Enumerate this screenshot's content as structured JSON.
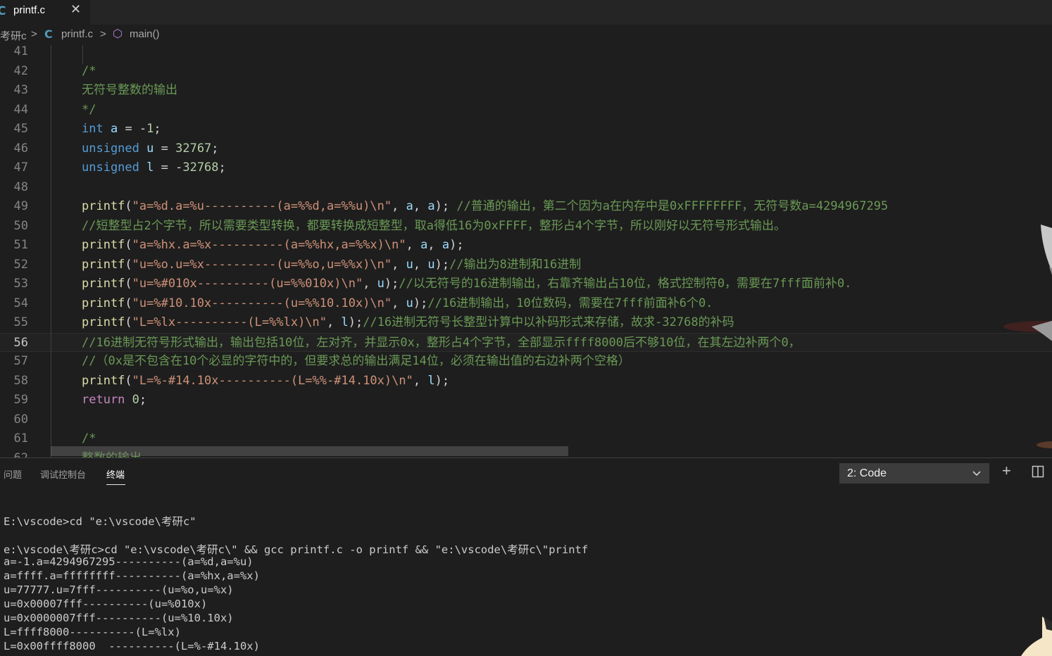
{
  "tab": {
    "icon": "C",
    "label": "printf.c",
    "close": "✕"
  },
  "breadcrumb": {
    "folder": "考研c",
    "sep": ">",
    "file_icon": "C",
    "file": "printf.c",
    "symbol_icon": "⬡",
    "symbol": "main()"
  },
  "editor": {
    "lines": [
      {
        "n": "41",
        "tokens": []
      },
      {
        "n": "42",
        "tokens": [
          [
            "cmt",
            "/*"
          ]
        ]
      },
      {
        "n": "43",
        "tokens": [
          [
            "cmt",
            "无符号整数的输出"
          ]
        ]
      },
      {
        "n": "44",
        "tokens": [
          [
            "cmt",
            "*/"
          ]
        ]
      },
      {
        "n": "45",
        "tokens": [
          [
            "kw",
            "int"
          ],
          [
            "pun",
            " "
          ],
          [
            "var",
            "a"
          ],
          [
            "pun",
            " = -"
          ],
          [
            "num",
            "1"
          ],
          [
            "pun",
            ";"
          ]
        ]
      },
      {
        "n": "46",
        "tokens": [
          [
            "kw",
            "unsigned"
          ],
          [
            "pun",
            " "
          ],
          [
            "var",
            "u"
          ],
          [
            "pun",
            " = "
          ],
          [
            "num",
            "32767"
          ],
          [
            "pun",
            ";"
          ]
        ]
      },
      {
        "n": "47",
        "tokens": [
          [
            "kw",
            "unsigned"
          ],
          [
            "pun",
            " "
          ],
          [
            "var",
            "l"
          ],
          [
            "pun",
            " = -"
          ],
          [
            "num",
            "32768"
          ],
          [
            "pun",
            ";"
          ]
        ]
      },
      {
        "n": "48",
        "tokens": []
      },
      {
        "n": "49",
        "tokens": [
          [
            "fn",
            "printf"
          ],
          [
            "pun",
            "("
          ],
          [
            "str",
            "\"a=%d.a=%u----------(a=%%d,a=%%u)\\n\""
          ],
          [
            "pun",
            ", "
          ],
          [
            "var",
            "a"
          ],
          [
            "pun",
            ", "
          ],
          [
            "var",
            "a"
          ],
          [
            "pun",
            "); "
          ],
          [
            "cmt",
            "//普通的输出，第二个因为a在内存中是0xFFFFFFFF，无符号数a=4294967295"
          ]
        ]
      },
      {
        "n": "50",
        "tokens": [
          [
            "cmt",
            "//短整型占2个字节，所以需要类型转换，都要转换成短整型，取a得低16为0xFFFF，整形占4个字节，所以刚好以无符号形式输出。"
          ]
        ]
      },
      {
        "n": "51",
        "tokens": [
          [
            "fn",
            "printf"
          ],
          [
            "pun",
            "("
          ],
          [
            "str",
            "\"a=%hx.a=%x----------(a=%%hx,a=%%x)\\n\""
          ],
          [
            "pun",
            ", "
          ],
          [
            "var",
            "a"
          ],
          [
            "pun",
            ", "
          ],
          [
            "var",
            "a"
          ],
          [
            "pun",
            ");"
          ]
        ]
      },
      {
        "n": "52",
        "tokens": [
          [
            "fn",
            "printf"
          ],
          [
            "pun",
            "("
          ],
          [
            "str",
            "\"u=%o.u=%x----------(u=%%o,u=%%x)\\n\""
          ],
          [
            "pun",
            ", "
          ],
          [
            "var",
            "u"
          ],
          [
            "pun",
            ", "
          ],
          [
            "var",
            "u"
          ],
          [
            "pun",
            ");"
          ],
          [
            "cmt",
            "//输出为8进制和16进制"
          ]
        ]
      },
      {
        "n": "53",
        "tokens": [
          [
            "fn",
            "printf"
          ],
          [
            "pun",
            "("
          ],
          [
            "str",
            "\"u=%#010x----------(u=%%010x)\\n\""
          ],
          [
            "pun",
            ", "
          ],
          [
            "var",
            "u"
          ],
          [
            "pun",
            ");"
          ],
          [
            "cmt",
            "//以无符号的16进制输出，右靠齐输出占10位，格式控制符0，需要在7fff面前补0."
          ]
        ]
      },
      {
        "n": "54",
        "tokens": [
          [
            "fn",
            "printf"
          ],
          [
            "pun",
            "("
          ],
          [
            "str",
            "\"u=%#10.10x----------(u=%%10.10x)\\n\""
          ],
          [
            "pun",
            ", "
          ],
          [
            "var",
            "u"
          ],
          [
            "pun",
            ");"
          ],
          [
            "cmt",
            "//16进制输出，10位数码，需要在7fff前面补6个0."
          ]
        ]
      },
      {
        "n": "55",
        "tokens": [
          [
            "fn",
            "printf"
          ],
          [
            "pun",
            "("
          ],
          [
            "str",
            "\"L=%lx----------(L=%%lx)\\n\""
          ],
          [
            "pun",
            ", "
          ],
          [
            "var",
            "l"
          ],
          [
            "pun",
            ");"
          ],
          [
            "cmt",
            "//16进制无符号长整型计算中以补码形式来存储，故求-32768的补码"
          ]
        ]
      },
      {
        "n": "56",
        "tokens": [
          [
            "cmt",
            "//16进制无符号形式输出，输出包括10位，左对齐，并显示0x，整形占4个字节，全部显示ffff8000后不够10位，在其左边补两个0，"
          ]
        ],
        "active": true
      },
      {
        "n": "57",
        "tokens": [
          [
            "cmt",
            "//（0x是不包含在10个必显的字符中的，但要求总的输出满足14位，必须在输出值的右边补两个空格）"
          ]
        ]
      },
      {
        "n": "58",
        "tokens": [
          [
            "fn",
            "printf"
          ],
          [
            "pun",
            "("
          ],
          [
            "str",
            "\"L=%-#14.10x----------(L=%%-#14.10x)\\n\""
          ],
          [
            "pun",
            ", "
          ],
          [
            "var",
            "l"
          ],
          [
            "pun",
            ");"
          ]
        ]
      },
      {
        "n": "59",
        "tokens": [
          [
            "ctl",
            "return"
          ],
          [
            "pun",
            " "
          ],
          [
            "num",
            "0"
          ],
          [
            "pun",
            ";"
          ]
        ]
      },
      {
        "n": "60",
        "tokens": []
      },
      {
        "n": "61",
        "tokens": [
          [
            "cmt",
            "/*"
          ]
        ]
      },
      {
        "n": "62",
        "tokens": [
          [
            "cmt",
            "整数的输出"
          ]
        ]
      }
    ]
  },
  "panel": {
    "tabs": [
      "问题",
      "调试控制台",
      "终端"
    ],
    "terminal_select": "2: Code",
    "add_icon": "+",
    "split_icon": "◫",
    "terminal_lines": [
      "E:\\vscode>cd \"e:\\vscode\\考研c\"",
      "",
      "e:\\vscode\\考研c>cd \"e:\\vscode\\考研c\\\" && gcc printf.c -o printf && \"e:\\vscode\\考研c\\\"printf",
      "a=-1.a=4294967295----------(a=%d,a=%u)",
      "a=ffff.a=ffffffff----------(a=%hx,a=%x)",
      "u=77777.u=7fff----------(u=%o,u=%x)",
      "u=0x00007fff----------(u=%010x)",
      "u=0x0000007fff----------(u=%10.10x)",
      "L=ffff8000----------(L=%lx)",
      "L=0x00ffff8000  ----------(L=%-#14.10x)"
    ]
  }
}
